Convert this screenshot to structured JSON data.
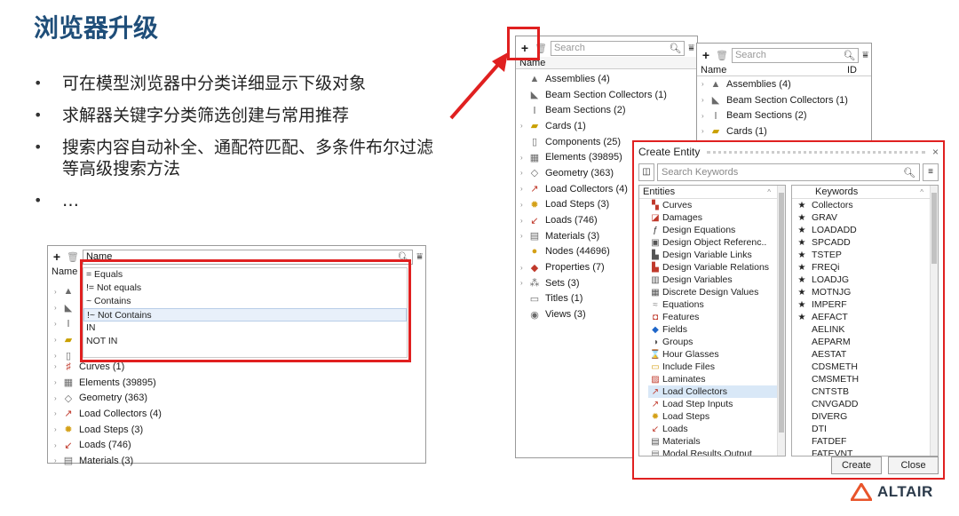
{
  "title": "浏览器升级",
  "bullets": [
    "可在模型浏览器中分类详细显示下级对象",
    "求解器关键字分类筛选创建与常用推荐",
    "搜索内容自动补全、通配符匹配、多条件布尔过滤等高级搜索方法",
    "…"
  ],
  "panelA": {
    "search_value": "Name",
    "header": "Name",
    "dropdown": [
      "= Equals",
      "!= Not equals",
      "~ Contains",
      "!~ Not Contains",
      "IN",
      "NOT IN"
    ],
    "rows": [
      {
        "label": "Curves (1)"
      },
      {
        "label": "Elements  (39895)"
      },
      {
        "label": "Geometry  (363)"
      },
      {
        "label": "Load Collectors  (4)"
      },
      {
        "label": "Load Steps  (3)"
      },
      {
        "label": "Loads  (746)"
      },
      {
        "label": "Materials  (3)"
      }
    ]
  },
  "panelB": {
    "search_placeholder": "Search",
    "header": "Name",
    "rows": [
      {
        "label": "Assemblies  (4)"
      },
      {
        "label": "Beam Section Collectors  (1)"
      },
      {
        "label": "Beam Sections  (2)"
      },
      {
        "label": "Cards  (1)"
      },
      {
        "label": "Components  (25)"
      },
      {
        "label": "Elements  (39895)"
      },
      {
        "label": "Geometry  (363)"
      },
      {
        "label": "Load Collectors  (4)"
      },
      {
        "label": "Load Steps  (3)"
      },
      {
        "label": "Loads  (746)"
      },
      {
        "label": "Materials  (3)"
      },
      {
        "label": "Nodes  (44696)"
      },
      {
        "label": "Properties  (7)"
      },
      {
        "label": "Sets  (3)"
      },
      {
        "label": "Titles  (1)"
      },
      {
        "label": "Views  (3)"
      }
    ]
  },
  "panelC": {
    "search_placeholder": "Search",
    "header_name": "Name",
    "header_id": "ID",
    "rows": [
      {
        "label": "Assemblies  (4)"
      },
      {
        "label": "Beam Section Collectors  (1)"
      },
      {
        "label": "Beam Sections  (2)"
      },
      {
        "label": "Cards  (1)"
      }
    ]
  },
  "createEntity": {
    "title": "Create Entity",
    "search_placeholder": "Search Keywords",
    "entities_header": "Entities",
    "keywords_header": "Keywords",
    "entities": [
      "Curves",
      "Damages",
      "Design Equations",
      "Design Object Referenc..",
      "Design Variable Links",
      "Design Variable Relations",
      "Design Variables",
      "Discrete Design Values",
      "Equations",
      "Features",
      "Fields",
      "Groups",
      "Hour Glasses",
      "Include Files",
      "Laminates",
      "Load Collectors",
      "Load Step Inputs",
      "Load Steps",
      "Loads",
      "Materials",
      "Modal Results Output"
    ],
    "keywords": [
      "Collectors",
      "GRAV",
      "LOADADD",
      "SPCADD",
      "TSTEP",
      "FREQi",
      "LOADJG",
      "MOTNJG",
      "IMPERF",
      "AEFACT",
      "AELINK",
      "AEPARM",
      "AESTAT",
      "CDSMETH",
      "CMSMETH",
      "CNTSTB",
      "CNVGADD",
      "DIVERG",
      "DTI",
      "FATDEF",
      "FATEVNT"
    ],
    "starred_count": 10,
    "create_label": "Create",
    "close_label": "Close"
  },
  "logo": {
    "text": "ALTAIR"
  },
  "colors": {
    "title": "#1f4e79",
    "highlight": "#e02020",
    "logo": "#e8542a"
  }
}
